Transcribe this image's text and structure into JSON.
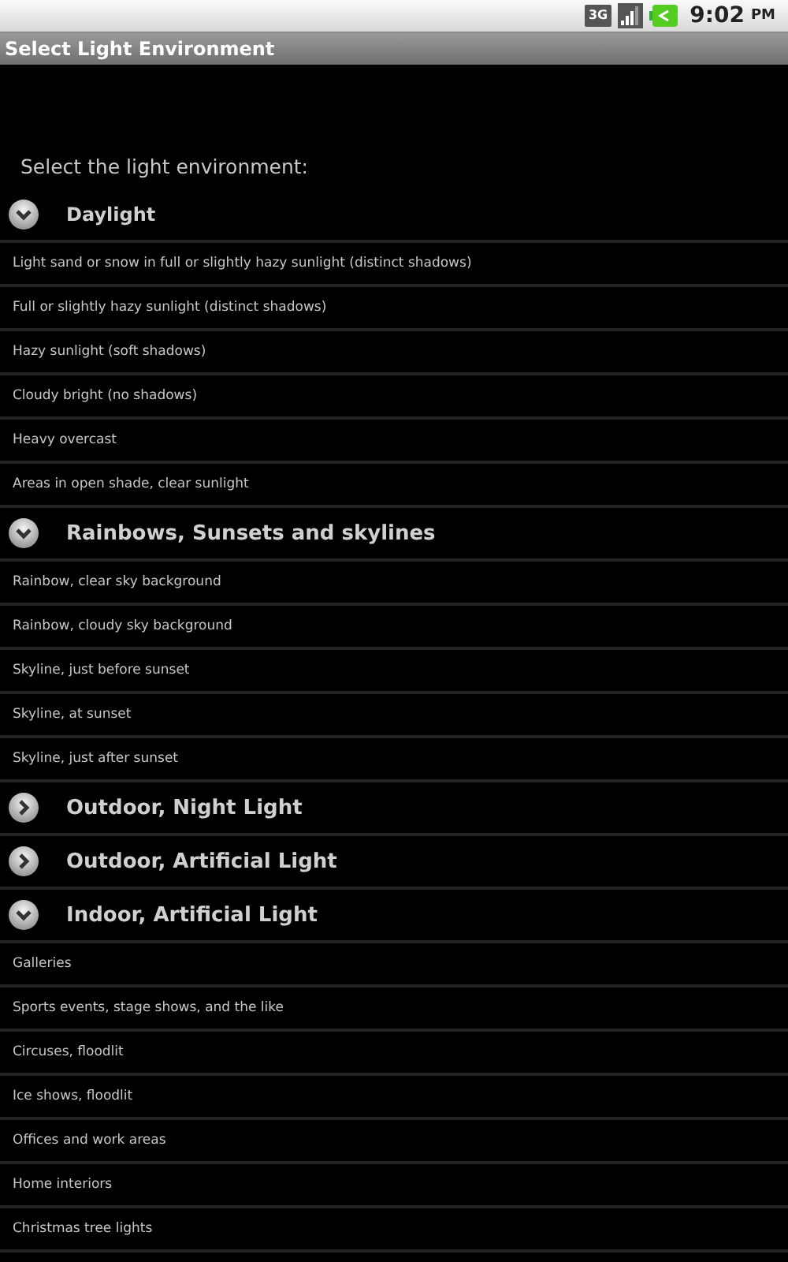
{
  "status_bar": {
    "network": "3G",
    "time": "9:02",
    "meridiem": "PM"
  },
  "window": {
    "title": "Select Light Environment"
  },
  "prompt": "Select the light environment:",
  "groups": [
    {
      "label": "Daylight",
      "expanded": true,
      "items": [
        "Light sand or snow in full or slightly hazy sunlight (distinct shadows)",
        "Full or slightly hazy sunlight (distinct shadows)",
        "Hazy sunlight (soft shadows)",
        "Cloudy bright (no shadows)",
        "Heavy overcast",
        "Areas in open shade, clear sunlight"
      ]
    },
    {
      "label": "Rainbows, Sunsets and skylines",
      "expanded": true,
      "items": [
        "Rainbow, clear sky background",
        "Rainbow, cloudy sky background",
        "Skyline, just before sunset",
        "Skyline, at sunset",
        "Skyline, just after sunset"
      ]
    },
    {
      "label": "Outdoor, Night Light",
      "expanded": false
    },
    {
      "label": "Outdoor, Artificial Light",
      "expanded": false
    },
    {
      "label": "Indoor, Artificial Light",
      "expanded": true,
      "items": [
        "Galleries",
        "Sports events, stage shows, and the like",
        "Circuses, floodlit",
        "Ice shows, floodlit",
        "Offices and work areas",
        "Home interiors",
        "Christmas tree lights"
      ]
    }
  ]
}
